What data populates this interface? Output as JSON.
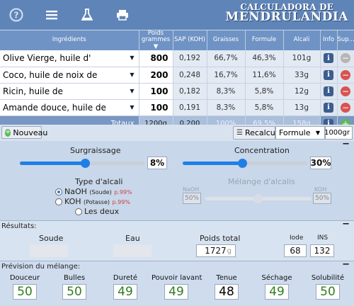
{
  "header": {
    "icons": [
      "help-icon",
      "menu-icon",
      "flask-icon",
      "print-icon"
    ],
    "logo_line1": "CALCULADORA DE",
    "logo_line2": "MENDRULANDIA"
  },
  "table": {
    "headers": {
      "ingredients": "Ingrédients",
      "poids": "Poids grammes ▼",
      "sap": "SAP (KOH)",
      "graisses": "Graisses",
      "formule": "Formule",
      "alcali": "Alcali",
      "info": "Info",
      "sup": "Sup..."
    },
    "rows": [
      {
        "name": "Olive Vierge, huile d'",
        "poids": "800",
        "sap": "0,192",
        "graisses": "66,7%",
        "formule": "46,3%",
        "alcali": "101g"
      },
      {
        "name": "Coco, huile de noix de",
        "poids": "200",
        "sap": "0,248",
        "graisses": "16,7%",
        "formule": "11,6%",
        "alcali": "33g"
      },
      {
        "name": "Ricin, huile de",
        "poids": "100",
        "sap": "0,182",
        "graisses": "8,3%",
        "formule": "5,8%",
        "alcali": "12g"
      },
      {
        "name": "Amande douce, huile de",
        "poids": "100",
        "sap": "0,191",
        "graisses": "8,3%",
        "formule": "5,8%",
        "alcali": "13g"
      }
    ],
    "totals": {
      "label": "Totaux",
      "poids": "1200g",
      "sap": "0,200",
      "graisses": "100%",
      "formule": "69,5%",
      "alcali": "158g"
    }
  },
  "toolbar": {
    "nouveau_label": "Nouveau",
    "recalculer_label": "Recalculer",
    "formule_select": "Formule",
    "weight_value": "1000gr"
  },
  "settings": {
    "surgraissage_label": "Surgraissage",
    "surgraissage_value": "8%",
    "surgraissage_fraction": 0.52,
    "concentration_label": "Concentration",
    "concentration_value": "30%",
    "concentration_fraction": 0.48,
    "type_alcali_label": "Type d'alcali",
    "naoh_label": "NaOH",
    "naoh_sub": "(Soude)",
    "naoh_purity": "p.99%",
    "koh_label": "KOH",
    "koh_sub": "(Potasse)",
    "koh_purity": "p.99%",
    "les_deux_label": "Les deux",
    "melange_label": "Mélange d'alcalis",
    "melange_naoh": "NaOH",
    "melange_koh": "KOH",
    "melange_naoh_value": "50%",
    "melange_koh_value": "50%"
  },
  "resultats": {
    "label": "Résultats:",
    "soude_label": "Soude",
    "eau_label": "Eau",
    "poids_total_label": "Poids total",
    "poids_total_value": "1727",
    "poids_total_unit": "g",
    "iode_label": "Iode",
    "iode_value": "68",
    "ins_label": "INS",
    "ins_value": "132"
  },
  "prevision": {
    "label": "Prévision du mélange:",
    "items": [
      {
        "label": "Douceur",
        "value": "50",
        "color": "#2e7d1f"
      },
      {
        "label": "Bulles",
        "value": "50",
        "color": "#2e7d1f"
      },
      {
        "label": "Dureté",
        "value": "49",
        "color": "#2e7d1f"
      },
      {
        "label": "Pouvoir lavant",
        "value": "49",
        "color": "#2e7d1f"
      },
      {
        "label": "Tenue",
        "value": "48",
        "color": "#000000"
      },
      {
        "label": "Séchage",
        "value": "49",
        "color": "#2e7d1f"
      },
      {
        "label": "Solubilité",
        "value": "50",
        "color": "#2e7d1f"
      }
    ]
  }
}
